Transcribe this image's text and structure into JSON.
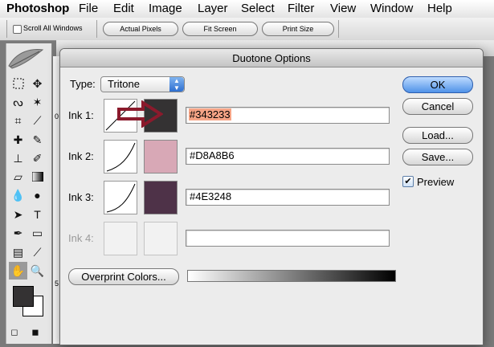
{
  "menubar": {
    "items": [
      "Photoshop",
      "File",
      "Edit",
      "Image",
      "Layer",
      "Select",
      "Filter",
      "View",
      "Window",
      "Help"
    ]
  },
  "options_bar": {
    "scroll_all_windows": "Scroll All Windows",
    "actual_pixels": "Actual Pixels",
    "fit_screen": "Fit Screen",
    "print_size": "Print Size"
  },
  "ruler": {
    "mark0": "0",
    "mark5": "5"
  },
  "dialog": {
    "title": "Duotone Options",
    "type_label": "Type:",
    "type_value": "Tritone",
    "inks": [
      {
        "label": "Ink 1:",
        "hex": "#343233",
        "swatch": "#343233",
        "enabled": true,
        "highlighted": true
      },
      {
        "label": "Ink 2:",
        "hex": "#D8A8B6",
        "swatch": "#D8A8B6",
        "enabled": true,
        "highlighted": false
      },
      {
        "label": "Ink 3:",
        "hex": "#4E3248",
        "swatch": "#4E3248",
        "enabled": true,
        "highlighted": false
      },
      {
        "label": "Ink 4:",
        "hex": "",
        "swatch": "",
        "enabled": false,
        "highlighted": false
      }
    ],
    "overprint_label": "Overprint Colors...",
    "buttons": {
      "ok": "OK",
      "cancel": "Cancel",
      "load": "Load...",
      "save": "Save..."
    },
    "preview_label": "Preview",
    "preview_checked": true,
    "arrow_color": "#8B1A2C"
  },
  "toolbox": {
    "foreground_color": "#343233",
    "background_color": "#FFFFFF"
  }
}
